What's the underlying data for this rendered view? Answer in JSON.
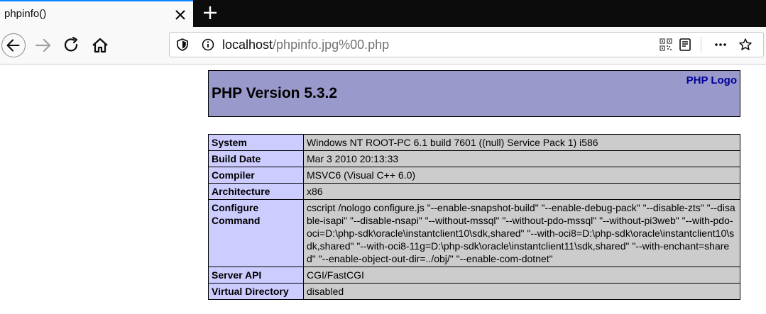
{
  "browser": {
    "tab_title": "phpinfo()",
    "url_host": "localhost",
    "url_path": "/phpinfo.jpg%00.php"
  },
  "page": {
    "version_heading": "PHP Version 5.3.2",
    "logo_alt": "PHP Logo",
    "rows": [
      {
        "key": "System",
        "value": "Windows NT ROOT-PC 6.1 build 7601 ((null) Service Pack 1) i586"
      },
      {
        "key": "Build Date",
        "value": "Mar 3 2010 20:13:33"
      },
      {
        "key": "Compiler",
        "value": "MSVC6 (Visual C++ 6.0)"
      },
      {
        "key": "Architecture",
        "value": "x86"
      },
      {
        "key": "Configure Command",
        "value": "cscript /nologo configure.js \"--enable-snapshot-build\" \"--enable-debug-pack\" \"--disable-zts\" \"--disable-isapi\" \"--disable-nsapi\" \"--without-mssql\" \"--without-pdo-mssql\" \"--without-pi3web\" \"--with-pdo-oci=D:\\php-sdk\\oracle\\instantclient10\\sdk,shared\" \"--with-oci8=D:\\php-sdk\\oracle\\instantclient10\\sdk,shared\" \"--with-oci8-11g=D:\\php-sdk\\oracle\\instantclient11\\sdk,shared\" \"--with-enchant=shared\" \"--enable-object-out-dir=../obj/\" \"--enable-com-dotnet\""
      },
      {
        "key": "Server API",
        "value": "CGI/FastCGI"
      },
      {
        "key": "Virtual Directory",
        "value": "disabled"
      }
    ]
  },
  "icons": [
    "close-icon",
    "plus-icon",
    "back-arrow-icon",
    "forward-arrow-icon",
    "reload-icon",
    "home-icon",
    "shield-icon",
    "info-icon",
    "qr-code-icon",
    "reader-view-icon",
    "more-dots-icon",
    "bookmark-star-icon"
  ]
}
